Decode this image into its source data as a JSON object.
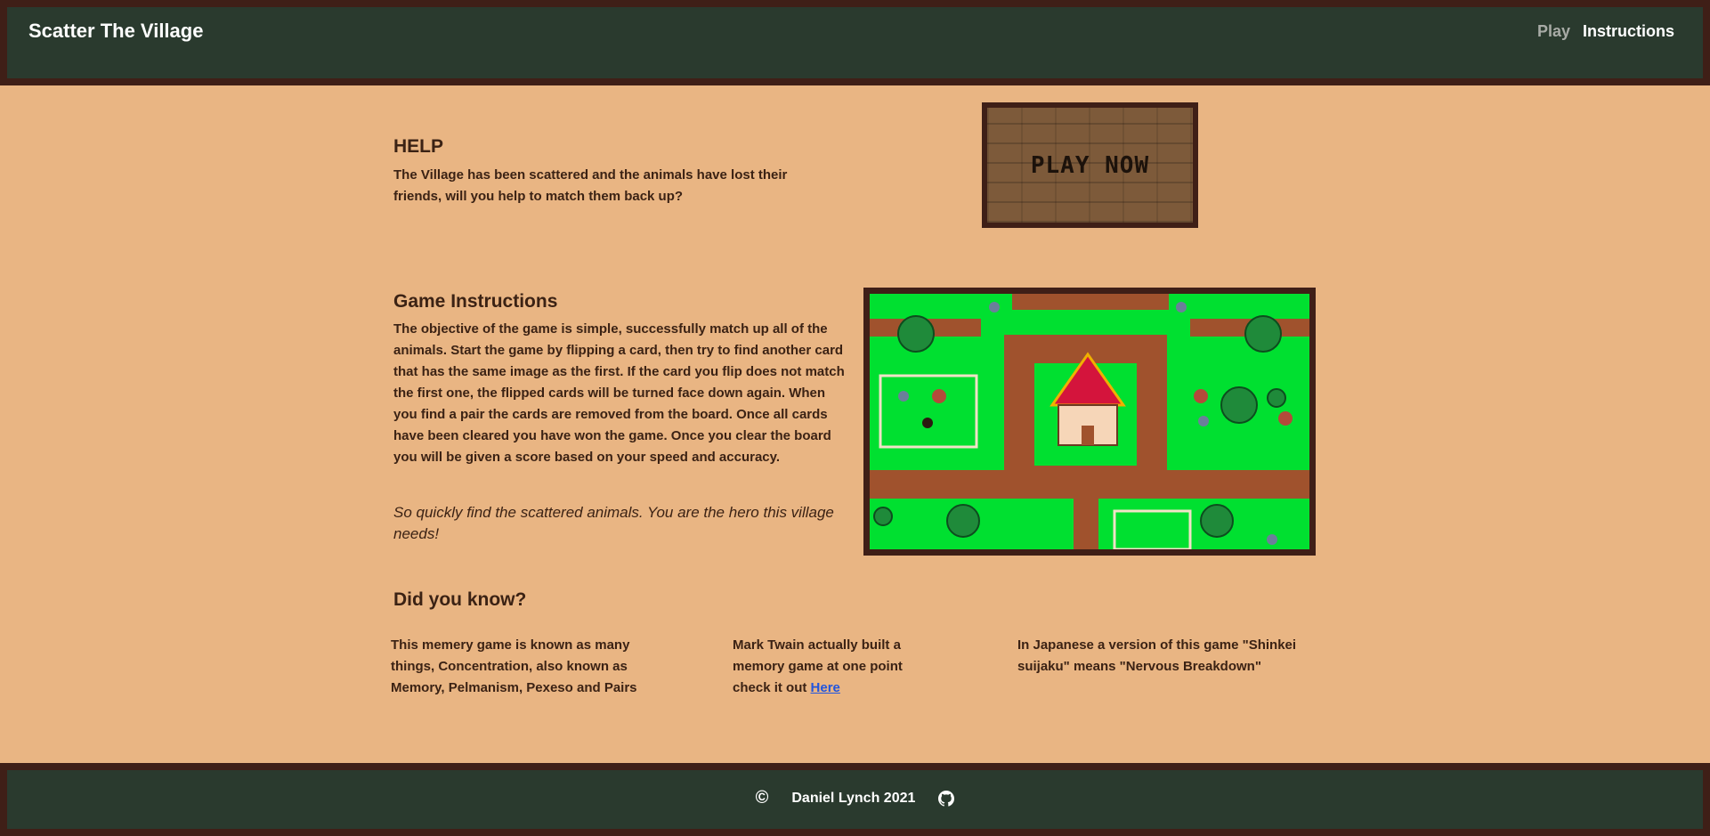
{
  "header": {
    "title": "Scatter The Village",
    "nav": {
      "play": "Play",
      "instructions": "Instructions"
    }
  },
  "help": {
    "title": "HELP",
    "text": "The Village has been scattered and the animals have lost their friends, will you help to match them back up?",
    "play_button": "PLAY NOW"
  },
  "instructions": {
    "title": "Game Instructions",
    "text": "The objective of the game is simple, successfully match up all of the animals. Start the game by flipping a card, then try to find another card that has the same image as the first. If the card you flip does not match the first one, the flipped cards will be turned face down again. When you find a pair the cards are removed from the board. Once all cards have been cleared you have won the game. Once you clear the board you will be given a score based on your speed and accuracy.",
    "tagline": "So quickly find the scattered animals. You are the hero this village needs!"
  },
  "did_you_know": {
    "title": "Did you know?",
    "fact1": "This memery game is known as many things, Concentration, also known as Memory, Pelmanism, Pexeso and Pairs",
    "fact2_prefix": "Mark Twain actually built a memory game at one point check it out",
    "fact2_link": "Here",
    "fact3": "In Japanese a version of this game \"Shinkei suijaku\" means \"Nervous Breakdown\""
  },
  "footer": {
    "copyright_icon": "copyright-icon",
    "text": "Daniel Lynch 2021",
    "github_icon": "github-icon"
  },
  "colors": {
    "page_bg": "#e9b583",
    "frame": "#3f1f17",
    "bar": "#2a3a2e",
    "grass": "#00e030",
    "path": "#a0522d",
    "roof": "#d4143c",
    "link": "#2255dd"
  }
}
